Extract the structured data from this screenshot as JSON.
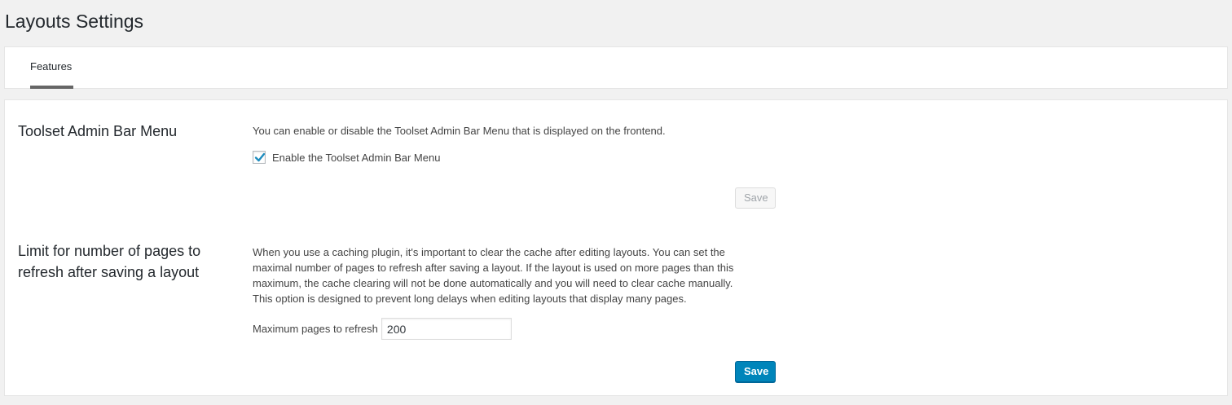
{
  "page": {
    "title": "Layouts Settings"
  },
  "tabs": [
    {
      "label": "Features",
      "active": true
    }
  ],
  "sections": {
    "admin_bar": {
      "title": "Toolset Admin Bar Menu",
      "description": "You can enable or disable the Toolset Admin Bar Menu that is displayed on the frontend.",
      "checkbox_label": "Enable the Toolset Admin Bar Menu",
      "checked": true,
      "save_label": "Save"
    },
    "cache_limit": {
      "title_line1": "Limit for number of pages to",
      "title_line2": "refresh after saving a layout",
      "desc_line1": "When you use a caching plugin, it's important to clear the cache after editing layouts. You can set the",
      "desc_line2": "maximal number of pages to refresh after saving a layout. If the layout is used on more pages than this",
      "desc_line3": "maximum, the cache clearing will not be done automatically and you will need to clear cache manually.",
      "desc_line4": "This option is designed to prevent long delays when editing layouts that display many pages.",
      "field_label": "Maximum pages to refresh",
      "field_value": "200",
      "save_label": "Save"
    }
  },
  "colors": {
    "primary": "#0085ba",
    "check": "#1e8cbe"
  },
  "icons": {
    "checkmark": "checkmark-icon"
  }
}
